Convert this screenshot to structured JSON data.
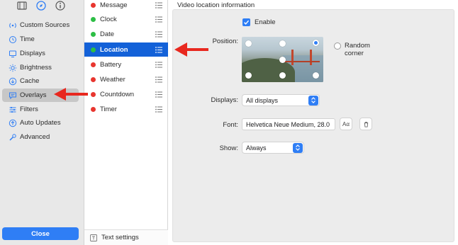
{
  "sidebar": {
    "top_icons": [
      "film-icon",
      "compass-icon",
      "info-icon"
    ],
    "items": [
      {
        "label": "Custom Sources",
        "icon": "antenna-icon",
        "selected": false
      },
      {
        "label": "Time",
        "icon": "clock-icon",
        "selected": false
      },
      {
        "label": "Displays",
        "icon": "display-icon",
        "selected": false
      },
      {
        "label": "Brightness",
        "icon": "sun-icon",
        "selected": false
      },
      {
        "label": "Cache",
        "icon": "download-circle-icon",
        "selected": false
      },
      {
        "label": "Overlays",
        "icon": "speech-bubble-icon",
        "selected": true
      },
      {
        "label": "Filters",
        "icon": "sliders-icon",
        "selected": false
      },
      {
        "label": "Auto Updates",
        "icon": "update-circle-icon",
        "selected": false
      },
      {
        "label": "Advanced",
        "icon": "wrench-icon",
        "selected": false
      }
    ],
    "close_label": "Close"
  },
  "overlays": {
    "items": [
      {
        "label": "Message",
        "status": "red",
        "selected": false
      },
      {
        "label": "Clock",
        "status": "green",
        "selected": false
      },
      {
        "label": "Date",
        "status": "green",
        "selected": false
      },
      {
        "label": "Location",
        "status": "green",
        "selected": true
      },
      {
        "label": "Battery",
        "status": "red",
        "selected": false
      },
      {
        "label": "Weather",
        "status": "red",
        "selected": false
      },
      {
        "label": "Countdown",
        "status": "red",
        "selected": false
      },
      {
        "label": "Timer",
        "status": "red",
        "selected": false
      }
    ],
    "footer_label": "Text settings"
  },
  "settings": {
    "section_title": "Video location information",
    "enable_label": "Enable",
    "enable_checked": true,
    "position_label": "Position:",
    "position_selected": "top-right",
    "random_corner_label": "Random corner",
    "random_corner_checked": false,
    "displays_label": "Displays:",
    "displays_value": "All displays",
    "font_label": "Font:",
    "font_value": "Helvetica Neue Medium, 28.0",
    "font_button_label": "Aα",
    "show_label": "Show:",
    "show_value": "Always"
  },
  "colors": {
    "accent": "#2f7ef5",
    "selection": "#1361d8",
    "status_red": "#e8362f",
    "status_green": "#2dbe45",
    "annotation_arrow": "#e8281f"
  }
}
